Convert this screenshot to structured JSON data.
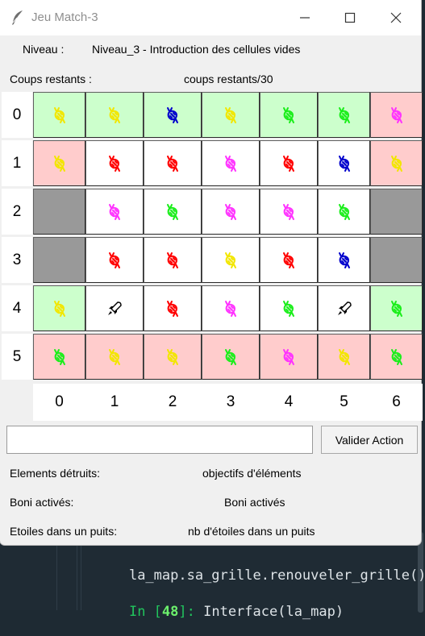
{
  "window": {
    "title": "Jeu Match-3"
  },
  "level": {
    "label": "Niveau :",
    "value": "Niveau_3 - Introduction des cellules vides"
  },
  "moves": {
    "label": "Coups restants :",
    "value": "coups restants/30"
  },
  "grid": {
    "row_headers": [
      "0",
      "1",
      "2",
      "3",
      "4",
      "5"
    ],
    "col_headers": [
      "0",
      "1",
      "2",
      "3",
      "4",
      "5",
      "6"
    ],
    "colors": {
      "green": "#ccffcc",
      "pink": "#ffcccc",
      "white": "#ffffff",
      "gray": "#999999"
    },
    "piece_colors": {
      "yellow": "#f2e600",
      "blue": "#0000cc",
      "pink": "#ff33ff",
      "red": "#ff0000",
      "green": "#1aee1a",
      "magenta": "#ff33ff"
    },
    "rows": [
      [
        {
          "bg": "green",
          "piece": "yellow"
        },
        {
          "bg": "green",
          "piece": "yellow"
        },
        {
          "bg": "green",
          "piece": "blue"
        },
        {
          "bg": "green",
          "piece": "yellow"
        },
        {
          "bg": "green",
          "piece": "green"
        },
        {
          "bg": "green",
          "piece": "green"
        },
        {
          "bg": "pink",
          "piece": "magenta"
        }
      ],
      [
        {
          "bg": "pink",
          "piece": "yellow"
        },
        {
          "bg": "white",
          "piece": "red"
        },
        {
          "bg": "white",
          "piece": "red"
        },
        {
          "bg": "white",
          "piece": "magenta"
        },
        {
          "bg": "white",
          "piece": "red"
        },
        {
          "bg": "white",
          "piece": "blue"
        },
        {
          "bg": "pink",
          "piece": "yellow"
        }
      ],
      [
        {
          "bg": "gray",
          "piece": ""
        },
        {
          "bg": "white",
          "piece": "magenta"
        },
        {
          "bg": "white",
          "piece": "green"
        },
        {
          "bg": "white",
          "piece": "magenta"
        },
        {
          "bg": "white",
          "piece": "magenta"
        },
        {
          "bg": "white",
          "piece": "green"
        },
        {
          "bg": "gray",
          "piece": ""
        }
      ],
      [
        {
          "bg": "gray",
          "piece": ""
        },
        {
          "bg": "white",
          "piece": "red"
        },
        {
          "bg": "white",
          "piece": "red"
        },
        {
          "bg": "white",
          "piece": "yellow"
        },
        {
          "bg": "white",
          "piece": "red"
        },
        {
          "bg": "white",
          "piece": "blue"
        },
        {
          "bg": "gray",
          "piece": ""
        }
      ],
      [
        {
          "bg": "green",
          "piece": "yellow"
        },
        {
          "bg": "white",
          "piece": "rocket"
        },
        {
          "bg": "white",
          "piece": "red"
        },
        {
          "bg": "white",
          "piece": "magenta"
        },
        {
          "bg": "white",
          "piece": "green"
        },
        {
          "bg": "white",
          "piece": "rocket"
        },
        {
          "bg": "green",
          "piece": "green"
        }
      ],
      [
        {
          "bg": "pink",
          "piece": "green"
        },
        {
          "bg": "pink",
          "piece": "yellow"
        },
        {
          "bg": "pink",
          "piece": "yellow"
        },
        {
          "bg": "pink",
          "piece": "green"
        },
        {
          "bg": "pink",
          "piece": "magenta"
        },
        {
          "bg": "pink",
          "piece": "yellow"
        },
        {
          "bg": "pink",
          "piece": "green"
        }
      ]
    ]
  },
  "action": {
    "input_value": "",
    "button_label": "Valider Action"
  },
  "stats": {
    "destroyed": {
      "label": "Elements détruits:",
      "value": "objectifs d'éléments"
    },
    "bonus": {
      "label": "Boni activés:",
      "value": "Boni activés"
    },
    "stars": {
      "label": "Etoiles dans un puits:",
      "value": "nb d'étoiles dans un puits"
    }
  },
  "console": {
    "line1_call": "la_map.sa_grille.renouveler_grille()",
    "line2_prompt": "In [",
    "line2_num": "48",
    "line2_close": "]:",
    "line2_call": " Interface(la_map)"
  }
}
